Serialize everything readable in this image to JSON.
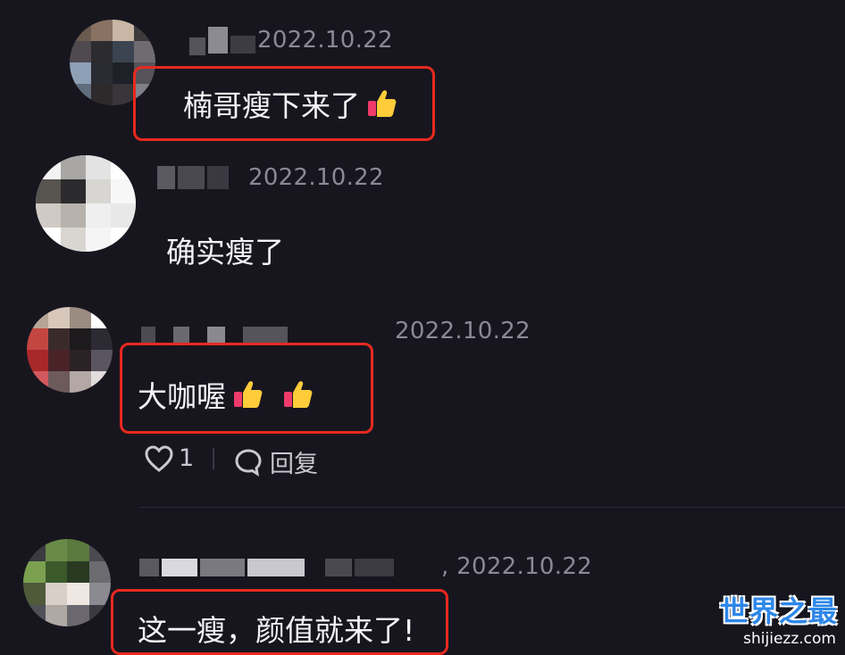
{
  "comments": [
    {
      "date": "2022.10.22",
      "text": "楠哥瘦下来了"
    },
    {
      "date": "2022.10.22",
      "text": "确实瘦了"
    },
    {
      "date": "2022.10.22",
      "text": "大咖喔",
      "likes": "1",
      "reply_label": "回复"
    },
    {
      "date": "2022.10.22",
      "text": "这一瘦，颜值就来了!"
    }
  ],
  "watermark": {
    "main": "世界之最",
    "sub": "shijiezz.com"
  },
  "colors": {
    "background": "#17161f",
    "highlight": "#e8291f",
    "date": "#8a8994"
  }
}
